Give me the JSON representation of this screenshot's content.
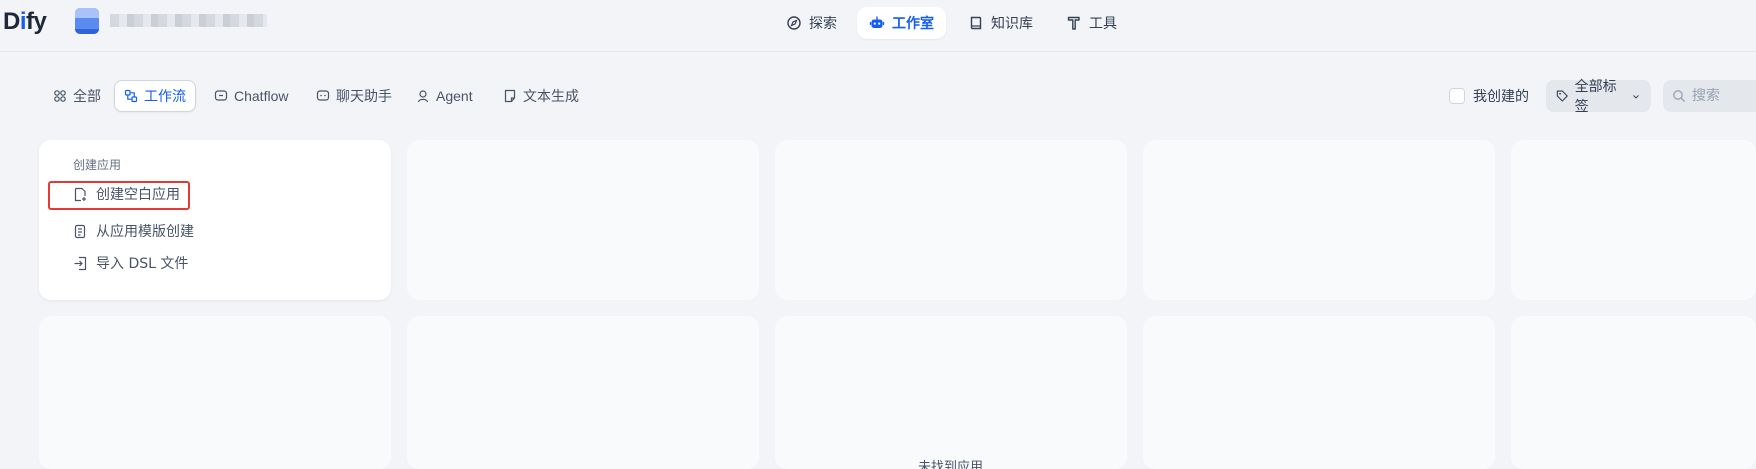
{
  "header": {
    "logo": {
      "prefix": "D",
      "accent": "i",
      "suffix": "fy"
    },
    "nav": [
      {
        "label": "探索",
        "icon": "compass-icon",
        "active": false
      },
      {
        "label": "工作室",
        "icon": "robot-icon",
        "active": true
      },
      {
        "label": "知识库",
        "icon": "book-icon",
        "active": false
      },
      {
        "label": "工具",
        "icon": "hammer-icon",
        "active": false
      }
    ]
  },
  "filters": {
    "tabs": [
      {
        "label": "全部",
        "icon": "grid-icon"
      },
      {
        "label": "工作流",
        "icon": "workflow-icon"
      },
      {
        "label": "Chatflow",
        "icon": "chat-bubble-icon"
      },
      {
        "label": "聊天助手",
        "icon": "chat-bot-icon"
      },
      {
        "label": "Agent",
        "icon": "agent-icon"
      },
      {
        "label": "文本生成",
        "icon": "document-icon"
      }
    ],
    "active_tab": "工作流",
    "mine_label": "我创建的",
    "tag_label": "全部标签",
    "search_placeholder": "搜索"
  },
  "create_card": {
    "title": "创建应用",
    "items": [
      {
        "label": "创建空白应用",
        "icon": "new-file-icon"
      },
      {
        "label": "从应用模版创建",
        "icon": "template-icon"
      },
      {
        "label": "导入 DSL 文件",
        "icon": "import-icon"
      }
    ]
  },
  "empty_state": {
    "text": "未找到应用"
  },
  "colors": {
    "accent": "#155eef",
    "background": "#f2f4f7",
    "highlight": "#e53935"
  }
}
